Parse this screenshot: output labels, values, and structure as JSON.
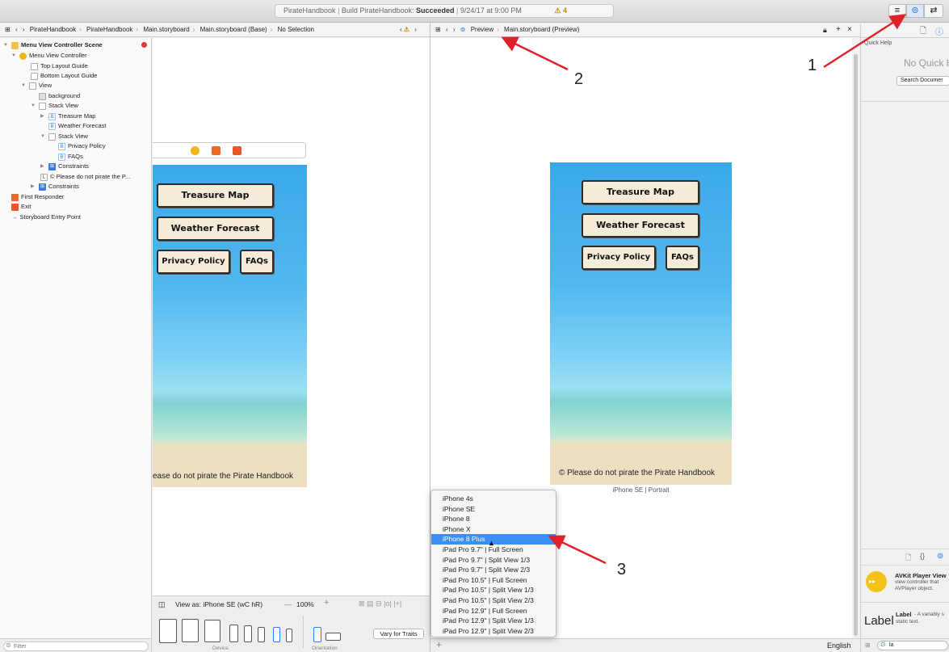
{
  "toolbar": {
    "project": "PirateHandbook",
    "build_prefix": "Build PirateHandbook:",
    "build_status": "Succeeded",
    "build_time": "9/24/17 at 9:00 PM",
    "warning_count": "4"
  },
  "editor_left": {
    "breadcrumbs": [
      "PirateHandbook",
      "PirateHandbook",
      "Main.storyboard",
      "Main.storyboard (Base)",
      "No Selection"
    ]
  },
  "editor_right": {
    "breadcrumbs": [
      "Preview",
      "Main.storyboard (Preview)"
    ]
  },
  "outline": {
    "items": [
      {
        "label": "Menu View Controller Scene"
      },
      {
        "label": "Menu View Controller"
      },
      {
        "label": "Top Layout Guide"
      },
      {
        "label": "Bottom Layout Guide"
      },
      {
        "label": "View"
      },
      {
        "label": "background"
      },
      {
        "label": "Stack View"
      },
      {
        "label": "Treasure Map"
      },
      {
        "label": "Weather Forecast"
      },
      {
        "label": "Stack View"
      },
      {
        "label": "Privacy Policy"
      },
      {
        "label": "FAQs"
      },
      {
        "label": "Constraints"
      },
      {
        "label": "© Please do not pirate the P..."
      },
      {
        "label": "Constraints"
      },
      {
        "label": "First Responder"
      },
      {
        "label": "Exit"
      },
      {
        "label": "Storyboard Entry Point"
      }
    ],
    "filter_placeholder": "Filter"
  },
  "scene_buttons": {
    "treasure": "Treasure Map",
    "weather": "Weather Forecast",
    "privacy": "Privacy Policy",
    "faqs": "FAQs"
  },
  "left_scene_footer": "ease do not pirate the Pirate Handbook",
  "preview_footer": "© Please do not pirate the Pirate Handbook",
  "preview_caption": "iPhone SE | Portrait",
  "canvas_bar": {
    "view_as": "View as: iPhone SE (wC hR)",
    "zoom": "100%",
    "vary_button": "Vary for Traits",
    "device_label": "Device",
    "orientation_label": "Orientation"
  },
  "device_menu": {
    "items": [
      "iPhone 4s",
      "iPhone SE",
      "iPhone 8",
      "iPhone X",
      "iPhone 8 Plus",
      "iPad Pro 9.7\" | Full Screen",
      "iPad Pro 9.7\" | Split View 1/3",
      "iPad Pro 9.7\" | Split View 2/3",
      "iPad Pro 10.5\" | Full Screen",
      "iPad Pro 10.5\" | Split View 1/3",
      "iPad Pro 10.5\" | Split View 2/3",
      "iPad Pro 12.9\" | Full Screen",
      "iPad Pro 12.9\" | Split View 1/3",
      "iPad Pro 12.9\" | Split View 2/3"
    ],
    "selected": "iPhone 8 Plus"
  },
  "preview_bottom": {
    "language": "English"
  },
  "inspector": {
    "title": "Quick Help",
    "no_help": "No Quick H",
    "search_button": "Search Documer",
    "lib_item1_title": "AVKit Player View",
    "lib_item1_desc1": "view controller that",
    "lib_item1_desc2": "AVPlayer object.",
    "lib_item2_big": "Label",
    "lib_item2_title": "Label",
    "lib_item2_desc1": "- A variably s",
    "lib_item2_desc2": "static text.",
    "search_value": "la"
  },
  "annotations": {
    "one": "1",
    "two": "2",
    "three": "3"
  },
  "colors": {
    "accent": "#3d8ef7",
    "annotation_arrow": "#e0202a",
    "sky": "#3aa8e8",
    "sand": "#ecdfc2"
  }
}
